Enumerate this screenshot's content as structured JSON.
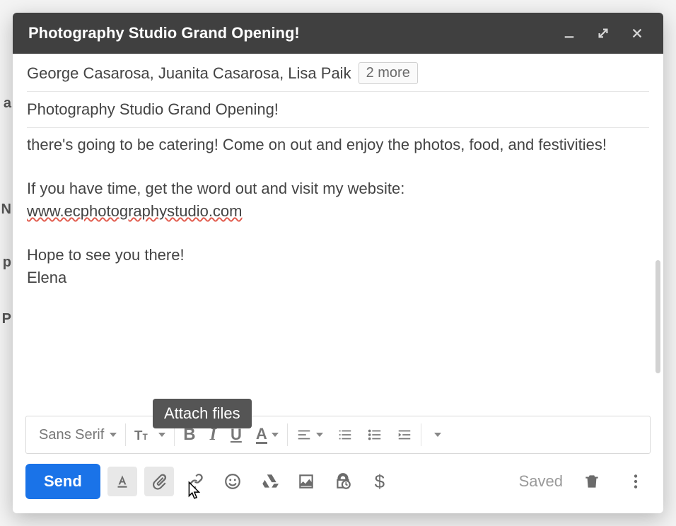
{
  "header": {
    "title": "Photography Studio Grand Opening!"
  },
  "recipients": {
    "text": "George Casarosa, Juanita Casarosa, Lisa Paik",
    "more": "2 more"
  },
  "subject": "Photography Studio Grand Opening!",
  "body": {
    "p1": "there's going to be catering! Come on out and enjoy the photos, food, and festivities!",
    "p2": "If you have time, get the word out and visit my website:",
    "link": "www.ecphotographystudio.com",
    "p3": "Hope to see you there!",
    "p4": "Elena"
  },
  "format_toolbar": {
    "font": "Sans Serif"
  },
  "tooltip": "Attach files",
  "bottombar": {
    "send": "Send",
    "saved": "Saved"
  }
}
